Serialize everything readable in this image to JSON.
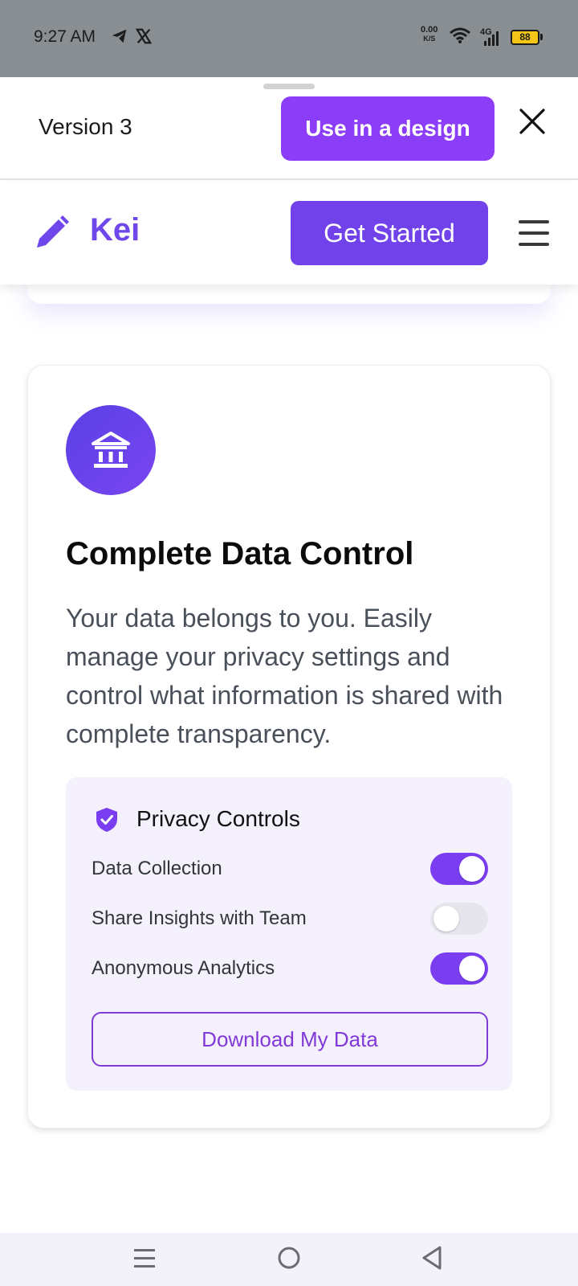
{
  "status_bar": {
    "time": "9:27 AM",
    "net_speed_value": "0.00",
    "net_speed_unit": "K/S",
    "network": "4G",
    "battery": "88",
    "icons": [
      "telegram-icon",
      "x-logo-icon",
      "wifi-icon",
      "signal-icon",
      "battery-icon"
    ]
  },
  "sheet_header": {
    "version": "Version 3",
    "use_button": "Use in a design",
    "close_icon": "close-icon"
  },
  "app_nav": {
    "logo_text": "Kei",
    "cta": "Get Started",
    "logo_icon": "pencil-icon",
    "menu_icon": "hamburger-menu-icon"
  },
  "feature": {
    "icon": "bank-icon",
    "title": "Complete Data Control",
    "description": "Your data belongs to you. Easily manage your privacy settings and control what information is shared with complete transparency.",
    "panel": {
      "title": "Privacy Controls",
      "icon": "shield-check-icon",
      "settings": [
        {
          "label": "Data Collection",
          "enabled": true
        },
        {
          "label": "Share Insights with Team",
          "enabled": false
        },
        {
          "label": "Anonymous Analytics",
          "enabled": true
        }
      ],
      "download_button": "Download My Data"
    }
  },
  "colors": {
    "brand_purple": "#7047eb",
    "button_purple": "#8b3df7",
    "panel_bg": "#f4f1fd",
    "status_bar": "#898e92"
  },
  "system_nav": {
    "icons": [
      "recents-icon",
      "home-icon",
      "back-icon"
    ]
  }
}
